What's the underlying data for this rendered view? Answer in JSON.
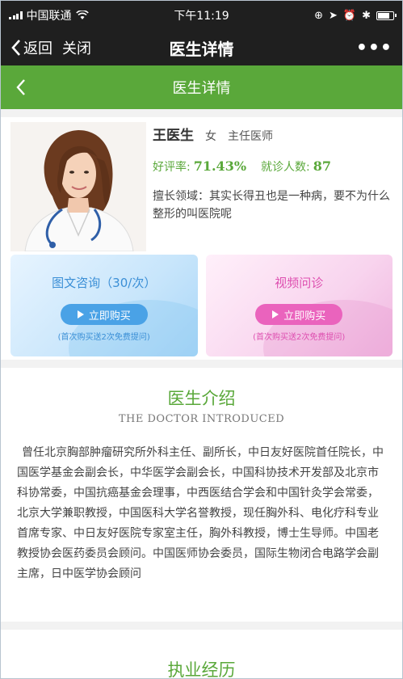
{
  "status_bar": {
    "carrier": "中国联通",
    "time": "下午11:19"
  },
  "wx_nav": {
    "back_label": "返回",
    "close_label": "关闭",
    "title": "医生详情",
    "more_label": "•••"
  },
  "header": {
    "title": "医生详情"
  },
  "doctor": {
    "name": "王医生",
    "gender": "女",
    "title": "主任医师",
    "rating_label": "好评率:",
    "rating_value": "71.43%",
    "visits_label": "就诊人数:",
    "visits_value": "87",
    "specialty": "擅长领域：其实长得丑也是一种病，要不为什么整形的叫医院呢"
  },
  "services": [
    {
      "title": "图文咨询（30/次）",
      "button": "立即购买",
      "note": "(首次购买送2次免费提问)",
      "color": "#4aa2e6"
    },
    {
      "title": "视频问诊",
      "button": "立即购买",
      "note": "(首次购买送2次免费提问)",
      "color": "#ea63bd"
    }
  ],
  "intro": {
    "title": "医生介绍",
    "subtitle": "THE DOCTOR INTRODUCED",
    "text": "曾任北京胸部肿瘤研究所外科主任、副所长，中日友好医院首任院长，中国医学基金会副会长，中华医学会副会长，中国科协技术开发部及北京市科协常委，中国抗癌基金会理事，中西医结合学会和中国针灸学会常委，北京大学兼职教授，中国医科大学名誉教授，现任胸外科、电化疗科专业首席专家、中日友好医院专家室主任，胸外科教授，博士生导师。中国老教授协会医药委员会顾问。中国医师协会委员，国际生物闭合电路学会副主席，日中医学协会顾问"
  },
  "practice": {
    "title": "执业经历"
  },
  "colors": {
    "accent_green": "#5aa83a",
    "bar_dark": "#1f1f1f"
  }
}
